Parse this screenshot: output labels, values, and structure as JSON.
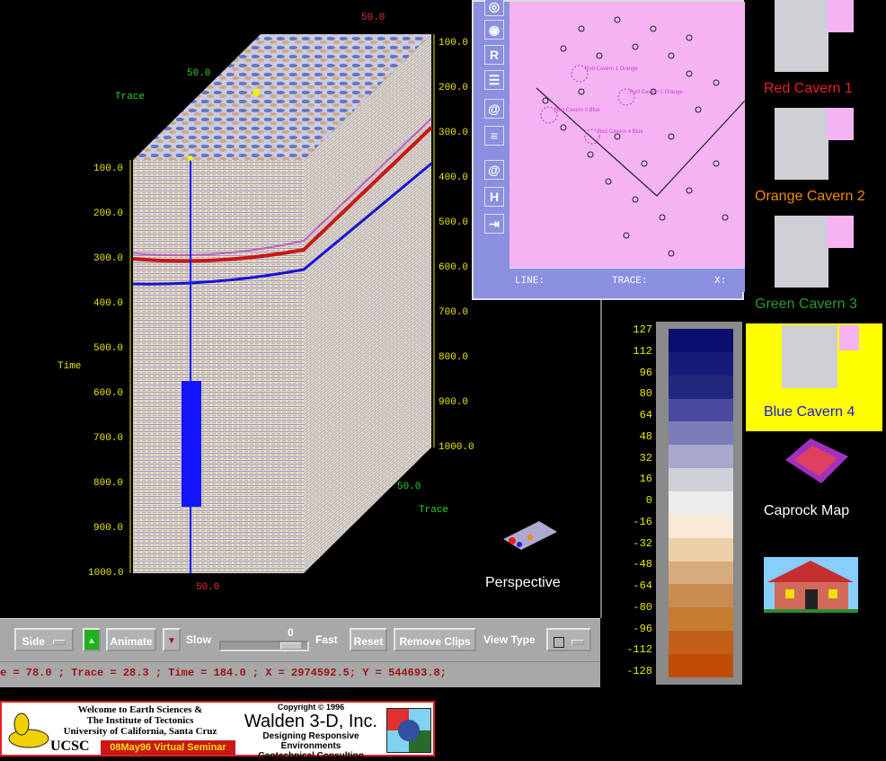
{
  "viewer": {
    "time_labels_left": [
      "100.0",
      "200.0",
      "300.0",
      "400.0",
      "500.0",
      "600.0",
      "700.0",
      "800.0",
      "900.0",
      "1000.0"
    ],
    "time_labels_right": [
      "100.0",
      "200.0",
      "300.0",
      "400.0",
      "500.0",
      "600.0",
      "700.0",
      "800.0",
      "900.0",
      "1000.0"
    ],
    "axis_trace_top": "Trace",
    "axis_trace_bottom": "Trace",
    "axis_time": "Time",
    "red_top_tick": "50.0",
    "red_bottom_tick": "50.0",
    "green_top_tick": "50.0",
    "green_bottom_tick": "50.0"
  },
  "controls": {
    "side_label": "Side",
    "up_arrow": "▲",
    "animate_label": "Animate",
    "down_arrow": "▼",
    "slow_label": "Slow",
    "slider_value": "0",
    "fast_label": "Fast",
    "reset_label": "Reset",
    "remove_clips_label": "Remove Clips",
    "view_type_label": "View Type"
  },
  "status": {
    "text": "e = 78.0    ; Trace = 28.3    ; Time = 184.0    ; X = 2974592.5; Y = 544693.8;"
  },
  "map": {
    "line_label": "LINE:",
    "trace_label": "TRACE:",
    "x_label": "X:",
    "tools": [
      "H"
    ],
    "cavern_labels": [
      "Red Cavern 1 Orange",
      "Red Cavern 2 Orange",
      "Red Cavern 3 Blue",
      "Red Cavern 4 Blue"
    ]
  },
  "colorbar": {
    "labels": [
      "127",
      "112",
      "96",
      "80",
      "64",
      "48",
      "32",
      "16",
      "0",
      "-16",
      "-32",
      "-48",
      "-64",
      "-80",
      "-96",
      "-112",
      "-128"
    ],
    "colors": [
      "#0a0e6e",
      "#161a78",
      "#22287e",
      "#4a4aa0",
      "#7c7cb8",
      "#a8a8cc",
      "#d0d0d8",
      "#ececec",
      "#f6ead6",
      "#ecd0a8",
      "#d8aa80",
      "#c88c52",
      "#c47c30",
      "#c26018",
      "#c04c08"
    ]
  },
  "thumbnails": [
    {
      "caption": "Red Cavern 1",
      "color": "#e82020"
    },
    {
      "caption": "Orange Cavern 2",
      "color": "#f08a00"
    },
    {
      "caption": "Green Cavern 3",
      "color": "#2a9a2a"
    },
    {
      "caption": "Blue Cavern 4",
      "color": "#1818e0",
      "highlight": "#ffff00"
    },
    {
      "caption": "Caprock Map",
      "color": "#ffffff"
    },
    {
      "caption": "Perspective",
      "color": "#ffffff"
    }
  ],
  "banner": {
    "welcome_line1": "Welcome to Earth Sciences &",
    "welcome_line2": "The Institute of Tectonics",
    "welcome_line3": "University of California, Santa Cruz",
    "ucsc": "UCSC",
    "seminar": "08May96 Virtual Seminar",
    "copyright": "Copyright © 1996",
    "company": "Walden 3-D, Inc.",
    "tagline1": "Designing Responsive Environments",
    "tagline2": "Geotechnical Consulting"
  }
}
